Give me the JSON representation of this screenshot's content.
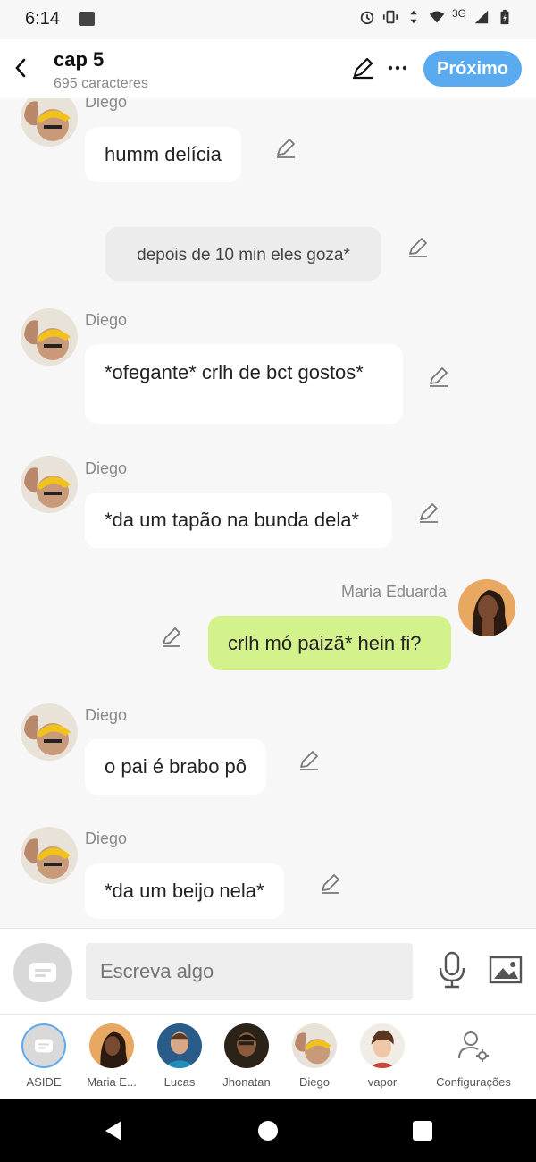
{
  "status": {
    "time": "6:14",
    "network": "3G"
  },
  "header": {
    "title": "cap 5",
    "subtitle": "695 caracteres",
    "next_label": "Próximo"
  },
  "messages": [
    {
      "sender": "Diego",
      "text": "humm delícia"
    },
    {
      "text": "depois de 10 min eles goza*"
    },
    {
      "sender": "Diego",
      "text": "*ofegante* crlh de bct gostos*"
    },
    {
      "sender": "Diego",
      "text": "*da um tapão na bunda dela*"
    },
    {
      "sender": "Maria Eduarda",
      "text": "crlh mó paizã* hein fi?"
    },
    {
      "sender": "Diego",
      "text": "o pai é brabo pô"
    },
    {
      "sender": "Diego",
      "text": "*da um beijo nela*"
    }
  ],
  "input": {
    "placeholder": "Escreva algo"
  },
  "characters": [
    {
      "label": "ASIDE"
    },
    {
      "label": "Maria E..."
    },
    {
      "label": "Lucas"
    },
    {
      "label": "Jhonatan"
    },
    {
      "label": "Diego"
    },
    {
      "label": "vapor"
    },
    {
      "label": "Configurações"
    }
  ],
  "colors": {
    "accent": "#5aaaf0",
    "own_bubble": "#d4f28c",
    "narration_bubble": "#ececec"
  }
}
